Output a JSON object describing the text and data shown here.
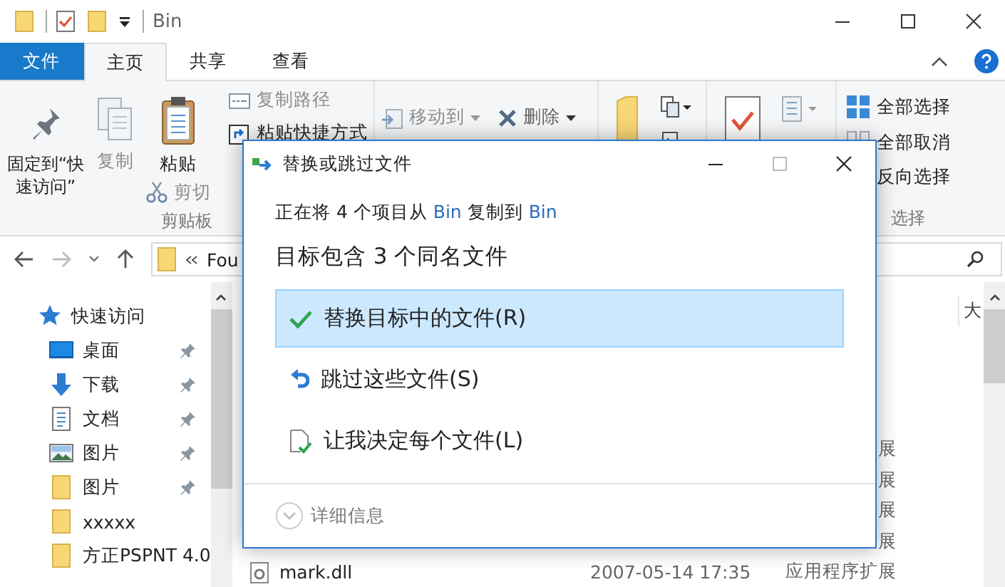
{
  "window": {
    "title": "Bin"
  },
  "ribbon_tabs": [
    {
      "label": "文件",
      "kind": "file",
      "selected": false
    },
    {
      "label": "主页",
      "kind": "tab",
      "selected": true
    },
    {
      "label": "共享",
      "kind": "tab",
      "selected": false
    },
    {
      "label": "查看",
      "kind": "tab",
      "selected": false
    }
  ],
  "ribbon": {
    "clipboard": {
      "pin": "固定到“快速访问”",
      "copy": "复制",
      "paste": "粘贴",
      "cut": "剪切",
      "copy_path": "复制路径",
      "paste_shortcut": "粘贴快捷方式",
      "group_label": "剪贴板"
    },
    "organize": {
      "move_to": "移动到",
      "delete": "删除"
    },
    "select": {
      "select_all": "全部选择",
      "select_none": "全部取消",
      "invert": "反向选择",
      "group_label": "选择"
    }
  },
  "address": {
    "path": "Fou"
  },
  "navigation": {
    "items": [
      {
        "label": "快速访问",
        "kind": "star",
        "pinned": false
      },
      {
        "label": "桌面",
        "kind": "desktop",
        "pinned": true
      },
      {
        "label": "下载",
        "kind": "download",
        "pinned": true
      },
      {
        "label": "文档",
        "kind": "document",
        "pinned": true
      },
      {
        "label": "图片",
        "kind": "pictures",
        "pinned": true
      },
      {
        "label": "图片",
        "kind": "folder",
        "pinned": true
      },
      {
        "label": "xxxxx",
        "kind": "folder",
        "pinned": false
      },
      {
        "label": "方正PSPNT 4.0",
        "kind": "folder",
        "pinned": false
      }
    ]
  },
  "file_list": {
    "column_header": "大",
    "rows": [
      {
        "type": "展"
      },
      {
        "type": "展"
      },
      {
        "type": "展"
      },
      {
        "type": "展"
      },
      {
        "name": "mark.dll",
        "date": "2007-05-14 17:35",
        "type": "应用程序扩展"
      }
    ]
  },
  "dialog": {
    "title": "替换或跳过文件",
    "status": [
      {
        "text": "正在将 4 个项目从 ",
        "kind": "plain"
      },
      {
        "text": "Bin",
        "kind": "link"
      },
      {
        "text": " 复制到 ",
        "kind": "plain"
      },
      {
        "text": "Bin",
        "kind": "link"
      }
    ],
    "heading": "目标包含 3 个同名文件",
    "options": [
      {
        "label": "替换目标中的文件(R)",
        "kind": "replace",
        "selected": true
      },
      {
        "label": "跳过这些文件(S)",
        "kind": "skip",
        "selected": false
      },
      {
        "label": "让我决定每个文件(L)",
        "kind": "decide",
        "selected": false
      }
    ],
    "details": "详细信息"
  }
}
